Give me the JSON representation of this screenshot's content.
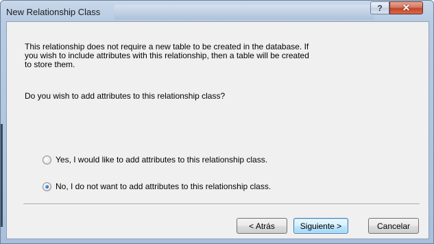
{
  "window": {
    "title": "New Relationship Class",
    "help_glyph": "?",
    "close_glyph": "✕"
  },
  "content": {
    "description_line1": "This relationship does not require a new table to be created in the database. If",
    "description_line2": "you wish to include attributes with this relationship, then a table will be created",
    "description_line3": "to store them.",
    "question": "Do you wish to add attributes to this relationship class?"
  },
  "options": [
    {
      "label": "Yes, I would like to add attributes to this relationship class.",
      "selected": false
    },
    {
      "label": "No, I do not want to add attributes to this relationship class.",
      "selected": true
    }
  ],
  "buttons": {
    "back": "< Atrás",
    "next": "Siguiente >",
    "cancel": "Cancelar"
  }
}
